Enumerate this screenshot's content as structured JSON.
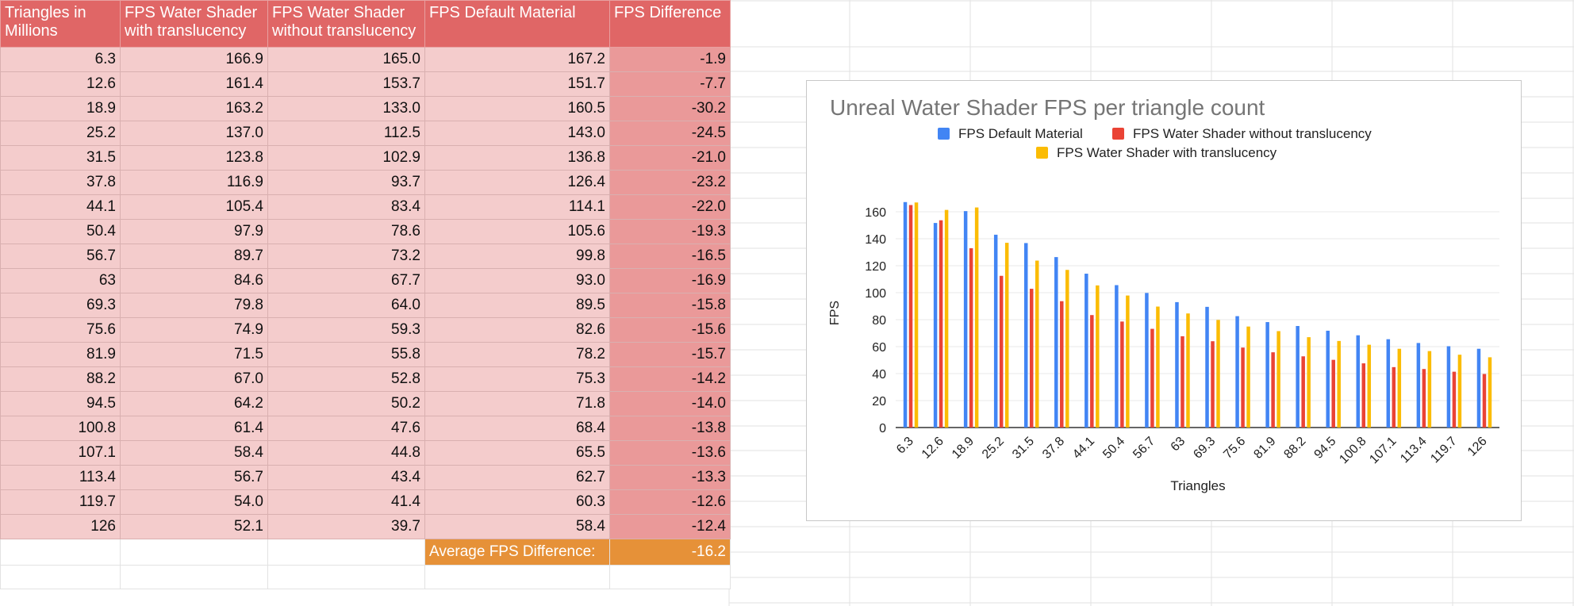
{
  "sheet": {
    "headers": [
      "Triangles in Millions",
      "FPS Water Shader with translucency",
      "FPS Water Shader without translucency",
      "FPS Default Material",
      "FPS Difference"
    ],
    "rows": [
      [
        "6.3",
        "166.9",
        "165.0",
        "167.2",
        "-1.9"
      ],
      [
        "12.6",
        "161.4",
        "153.7",
        "151.7",
        "-7.7"
      ],
      [
        "18.9",
        "163.2",
        "133.0",
        "160.5",
        "-30.2"
      ],
      [
        "25.2",
        "137.0",
        "112.5",
        "143.0",
        "-24.5"
      ],
      [
        "31.5",
        "123.8",
        "102.9",
        "136.8",
        "-21.0"
      ],
      [
        "37.8",
        "116.9",
        "93.7",
        "126.4",
        "-23.2"
      ],
      [
        "44.1",
        "105.4",
        "83.4",
        "114.1",
        "-22.0"
      ],
      [
        "50.4",
        "97.9",
        "78.6",
        "105.6",
        "-19.3"
      ],
      [
        "56.7",
        "89.7",
        "73.2",
        "99.8",
        "-16.5"
      ],
      [
        "63",
        "84.6",
        "67.7",
        "93.0",
        "-16.9"
      ],
      [
        "69.3",
        "79.8",
        "64.0",
        "89.5",
        "-15.8"
      ],
      [
        "75.6",
        "74.9",
        "59.3",
        "82.6",
        "-15.6"
      ],
      [
        "81.9",
        "71.5",
        "55.8",
        "78.2",
        "-15.7"
      ],
      [
        "88.2",
        "67.0",
        "52.8",
        "75.3",
        "-14.2"
      ],
      [
        "94.5",
        "64.2",
        "50.2",
        "71.8",
        "-14.0"
      ],
      [
        "100.8",
        "61.4",
        "47.6",
        "68.4",
        "-13.8"
      ],
      [
        "107.1",
        "58.4",
        "44.8",
        "65.5",
        "-13.6"
      ],
      [
        "113.4",
        "56.7",
        "43.4",
        "62.7",
        "-13.3"
      ],
      [
        "119.7",
        "54.0",
        "41.4",
        "60.3",
        "-12.6"
      ],
      [
        "126",
        "52.1",
        "39.7",
        "58.4",
        "-12.4"
      ]
    ],
    "average_label": "Average FPS Difference:",
    "average_value": "-16.2"
  },
  "colors": {
    "header_bg": "#e06666",
    "body_bg": "#f4cccc",
    "diff_bg": "#ea9999",
    "average_bg": "#e69138",
    "series_default": "#4285f4",
    "series_without": "#ea4335",
    "series_with": "#fbbc04"
  },
  "chart_data": {
    "type": "bar",
    "title": "Unreal Water Shader FPS per triangle count",
    "xlabel": "Triangles",
    "ylabel": "FPS",
    "ylim": [
      0,
      170
    ],
    "yticks": [
      0,
      20,
      40,
      60,
      80,
      100,
      120,
      140,
      160
    ],
    "grid": true,
    "legend_position": "top",
    "categories": [
      "6.3",
      "12.6",
      "18.9",
      "25.2",
      "31.5",
      "37.8",
      "44.1",
      "50.4",
      "56.7",
      "63",
      "69.3",
      "75.6",
      "81.9",
      "88.2",
      "94.5",
      "100.8",
      "107.1",
      "113.4",
      "119.7",
      "126"
    ],
    "series": [
      {
        "name": "FPS Default Material",
        "color": "#4285f4",
        "values": [
          167.2,
          151.7,
          160.5,
          143.0,
          136.8,
          126.4,
          114.1,
          105.6,
          99.8,
          93.0,
          89.5,
          82.6,
          78.2,
          75.3,
          71.8,
          68.4,
          65.5,
          62.7,
          60.3,
          58.4
        ]
      },
      {
        "name": "FPS Water Shader without translucency",
        "color": "#ea4335",
        "values": [
          165.0,
          153.7,
          133.0,
          112.5,
          102.9,
          93.7,
          83.4,
          78.6,
          73.2,
          67.7,
          64.0,
          59.3,
          55.8,
          52.8,
          50.2,
          47.6,
          44.8,
          43.4,
          41.4,
          39.7
        ]
      },
      {
        "name": "FPS Water Shader with translucency",
        "color": "#fbbc04",
        "values": [
          166.9,
          161.4,
          163.2,
          137.0,
          123.8,
          116.9,
          105.4,
          97.9,
          89.7,
          84.6,
          79.8,
          74.9,
          71.5,
          67.0,
          64.2,
          61.4,
          58.4,
          56.7,
          54.0,
          52.1
        ]
      }
    ]
  }
}
